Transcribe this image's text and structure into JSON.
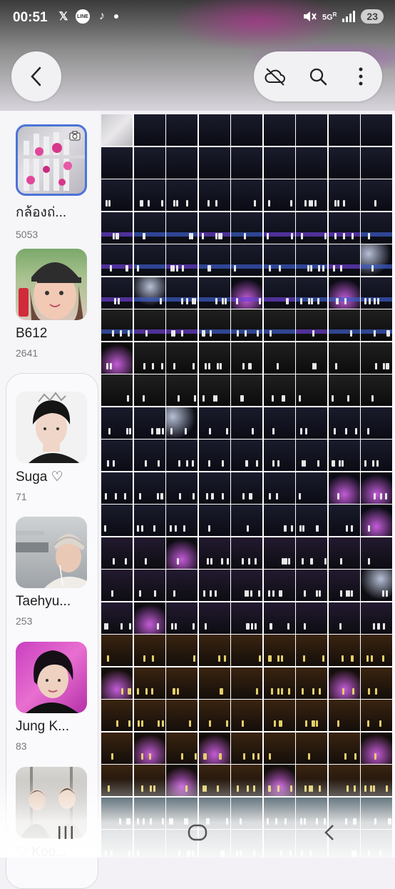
{
  "status_bar": {
    "time": "00:51",
    "battery": "23",
    "network": "5G",
    "network_sub": "R",
    "app_icons": [
      "x-icon",
      "line-icon",
      "tiktok-icon"
    ]
  },
  "toolbar": {
    "back_icon": "chevron-left-icon",
    "cloud_off_icon": "cloud-off-icon",
    "search_icon": "search-icon",
    "more_icon": "more-vertical-icon"
  },
  "albums": [
    {
      "name": "กล้องถ่...",
      "count": "5053"
    },
    {
      "name": "B612",
      "count": "2641"
    },
    {
      "name": "Suga ♡",
      "count": "71"
    },
    {
      "name": "Taehyu...",
      "count": "253"
    },
    {
      "name": "Jung K...",
      "count": "83"
    },
    {
      "name": "♡ Koo...",
      "count": ""
    }
  ],
  "colors": {
    "accent_border": "#4a74d8",
    "grid_gap": "#ffffff"
  },
  "navbar": {
    "recents_icon": "recents-icon",
    "home_icon": "home-icon",
    "back_icon": "nav-back-icon"
  }
}
